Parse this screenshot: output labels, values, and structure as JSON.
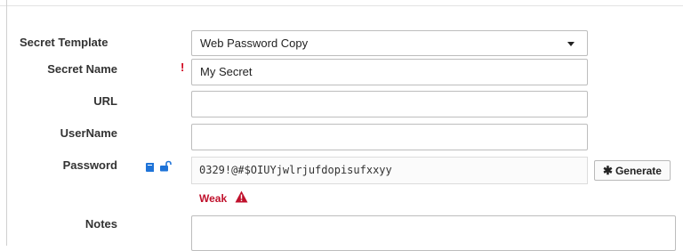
{
  "form": {
    "secret_template": {
      "label": "Secret Template",
      "value": "Web Password Copy"
    },
    "secret_name": {
      "label": "Secret Name",
      "required_mark": "!",
      "value": "My Secret"
    },
    "url": {
      "label": "URL",
      "value": ""
    },
    "username": {
      "label": "UserName",
      "value": ""
    },
    "password": {
      "label": "Password",
      "value": "0329!@#$OIUYjwlrjufdopisufxxyy",
      "strength": "Weak",
      "strength_color": "#c0112c",
      "icons": [
        "book-icon",
        "unlock-icon"
      ]
    },
    "generate_button": {
      "label": "Generate",
      "icon": "asterisk-icon"
    },
    "notes": {
      "label": "Notes",
      "value": ""
    }
  },
  "colors": {
    "accent_blue": "#1e73d8",
    "required_red": "#d0021b",
    "warning_red": "#c0112c"
  }
}
